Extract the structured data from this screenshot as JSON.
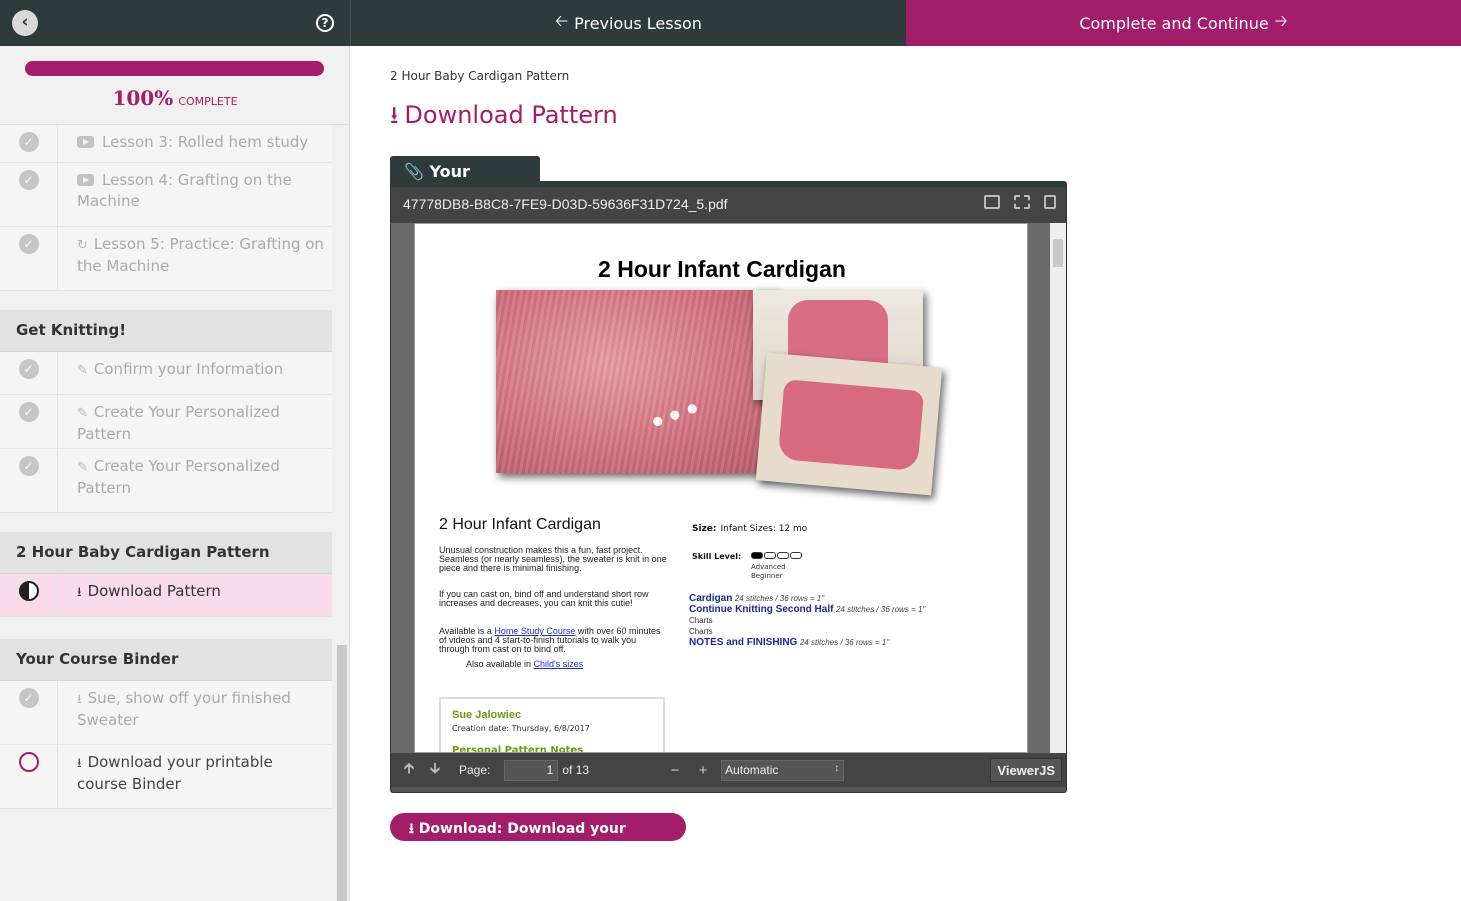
{
  "topbar": {
    "back_icon": "chevron-left-icon",
    "help_icon": "question-circle-icon",
    "previous_label": "Previous Lesson",
    "complete_label": "Complete and Continue"
  },
  "sidebar": {
    "progress": {
      "percent": 100,
      "percent_text": "100%",
      "complete_text": "COMPLETE",
      "color": "#a21d6a"
    },
    "lessons_top": [
      {
        "label": "Lesson 3: Rolled hem study",
        "icon": "youtube-icon",
        "status": "completed"
      },
      {
        "label": "Lesson 4: Grafting on the Machine",
        "icon": "youtube-icon",
        "status": "completed"
      },
      {
        "label": "Lesson 5: Practice: Grafting on the Machine",
        "icon": "refresh-icon",
        "status": "completed"
      }
    ],
    "sections": [
      {
        "title": "Get Knitting!",
        "lessons": [
          {
            "label": "Confirm your Information",
            "icon": "edit-icon",
            "status": "completed"
          },
          {
            "label": "Create Your Personalized Pattern",
            "icon": "edit-icon",
            "status": "completed"
          },
          {
            "label": "Create Your Personalized Pattern",
            "icon": "edit-icon",
            "status": "completed"
          }
        ]
      },
      {
        "title": "2 Hour Baby Cardigan Pattern",
        "lessons": [
          {
            "label": "Download Pattern",
            "icon": "download-icon",
            "status": "in-progress"
          }
        ]
      },
      {
        "title": "Your Course Binder",
        "lessons": [
          {
            "label": "Sue, show off your finished Sweater",
            "icon": "download-icon",
            "status": "completed"
          },
          {
            "label": "Download your printable course Binder",
            "icon": "download-icon",
            "status": "not-started"
          }
        ]
      }
    ]
  },
  "main": {
    "breadcrumb": "2 Hour Baby Cardigan Pattern",
    "title": "Download Pattern",
    "tab_label": "Your Pattern",
    "viewer": {
      "filename": "47778DB8-B8C8-7FE9-D03D-59636F31D724_5.pdf",
      "page_label": "Page:",
      "page_value": "1",
      "page_of": "of 13",
      "zoom_option": "Automatic",
      "brand": "ViewerJS"
    },
    "pdf": {
      "heading": "2 Hour Infant Cardigan",
      "subheading": "2 Hour Infant Cardigan",
      "para1": "Unusual construction makes this a fun, fast project. Seamless (or nearly seamless), the sweater is knit in one piece and there is minimal finishing.",
      "para2": "If you can cast on, bind off and understand short row increases and decreases, you can knit this cutie!",
      "para3_pre": "Available is a ",
      "para3_link": "Home Study Course",
      "para3_post": " with over 60 minutes of videos and 4 start-to-finish tutorials to walk you through from cast on to bind off.",
      "para4_pre": "Also available in ",
      "para4_link": "Child's sizes",
      "size_label": "Size:",
      "size_value": "Infant Sizes: 12 mo",
      "skill_label": "Skill Level:",
      "skill_level": 1,
      "skill_max": 4,
      "skill_text1": "Advanced",
      "skill_text2": "Beginner",
      "toc": [
        {
          "title": "Cardigan",
          "gauge": "24 stitches / 36 rows = 1\""
        },
        {
          "title": "Continue Knitting Second Half",
          "gauge": "24 stitches / 36 rows = 1\""
        }
      ],
      "toc_charts1": "Charts",
      "toc_charts2": "Charts",
      "toc_notes_title": "NOTES and FINISHING",
      "toc_notes_gauge": "24 stitches / 36 rows = 1\"",
      "card_name": "Sue Jalowiec",
      "card_date": "Creation date: Thursday, 6/8/2017",
      "card_cut": "Personal Pattern Notes"
    },
    "download_button": "Download: Download your pattern"
  }
}
